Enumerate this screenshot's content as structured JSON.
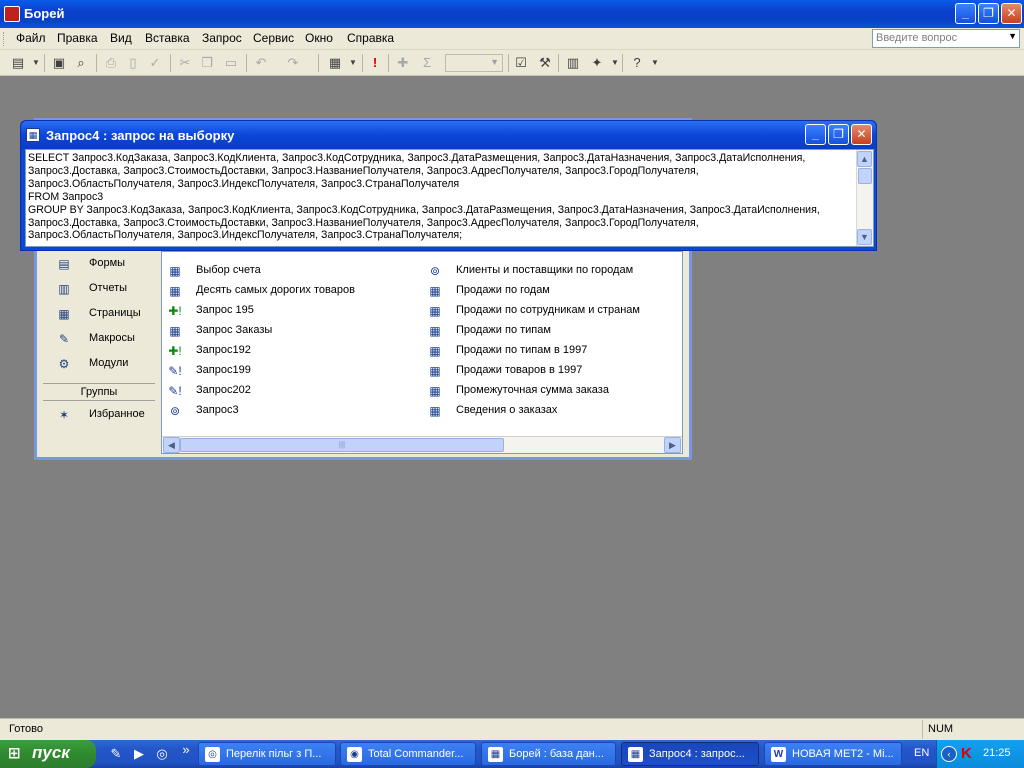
{
  "app": {
    "title": "Борей",
    "window_controls": {
      "minimize": "_",
      "maximize": "❐",
      "close": "✕"
    }
  },
  "menu": {
    "items": [
      "Файл",
      "Правка",
      "Вид",
      "Вставка",
      "Запрос",
      "Сервис",
      "Окно",
      "Справка"
    ],
    "help_placeholder": "Введите вопрос"
  },
  "toolbar": {
    "icons": [
      "view-icon",
      "save-icon",
      "print-preview-icon",
      "print-icon",
      "spell-check-icon",
      "cut-icon",
      "copy-icon",
      "paste-icon",
      "undo-icon",
      "redo-icon",
      "query-type-icon",
      "run-icon",
      "show-table-icon",
      "totals-icon",
      "properties-icon",
      "build-icon",
      "database-window-icon",
      "new-object-icon",
      "help-icon"
    ]
  },
  "query_window": {
    "title": "Запрос4 : запрос на выборку",
    "sql_lines": [
      "SELECT Запрос3.КодЗаказа, Запрос3.КодКлиента, Запрос3.КодСотрудника, Запрос3.ДатаРазмещения, Запрос3.ДатаНазначения, Запрос3.ДатаИсполнения,",
      "Запрос3.Доставка, Запрос3.СтоимостьДоставки, Запрос3.НазваниеПолучателя, Запрос3.АдресПолучателя, Запрос3.ГородПолучателя,",
      "Запрос3.ОбластьПолучателя, Запрос3.ИндексПолучателя, Запрос3.СтранаПолучателя",
      "FROM Запрос3",
      "GROUP BY Запрос3.КодЗаказа, Запрос3.КодКлиента, Запрос3.КодСотрудника, Запрос3.ДатаРазмещения, Запрос3.ДатаНазначения, Запрос3.ДатаИсполнения,",
      "Запрос3.Доставка, Запрос3.СтоимостьДоставки, Запрос3.НазваниеПолучателя, Запрос3.АдресПолучателя, Запрос3.ГородПолучателя,",
      "Запрос3.ОбластьПолучателя, Запрос3.ИндексПолучателя, Запрос3.СтранаПолучателя;"
    ]
  },
  "db_window": {
    "objects": [
      {
        "label": "Формы",
        "icon": "forms-icon",
        "glyph": "▤"
      },
      {
        "label": "Отчеты",
        "icon": "reports-icon",
        "glyph": "▥"
      },
      {
        "label": "Страницы",
        "icon": "pages-icon",
        "glyph": "▦"
      },
      {
        "label": "Макросы",
        "icon": "macros-icon",
        "glyph": "✎"
      },
      {
        "label": "Модули",
        "icon": "modules-icon",
        "glyph": "⚙"
      }
    ],
    "groups_header": "Группы",
    "groups": [
      {
        "label": "Избранное",
        "icon": "favorites-icon",
        "glyph": "✶"
      }
    ],
    "left_column": [
      {
        "label": "Выбор счета",
        "icon": "select-query-icon",
        "glyph": "▦"
      },
      {
        "label": "Десять самых дорогих товаров",
        "icon": "select-query-icon",
        "glyph": "▦"
      },
      {
        "label": "Запрос 195",
        "icon": "append-query-icon",
        "glyph": "✚!"
      },
      {
        "label": "Запрос Заказы",
        "icon": "select-query-icon",
        "glyph": "▦"
      },
      {
        "label": "Запрос192",
        "icon": "append-query-icon",
        "glyph": "✚!"
      },
      {
        "label": "Запрос199",
        "icon": "update-query-icon",
        "glyph": "✎!"
      },
      {
        "label": "Запрос202",
        "icon": "update-query-icon",
        "glyph": "✎!"
      },
      {
        "label": "Запрос3",
        "icon": "union-query-icon",
        "glyph": "⊚"
      }
    ],
    "right_column": [
      {
        "label": "Клиенты и поставщики по городам",
        "icon": "union-query-icon",
        "glyph": "⊚"
      },
      {
        "label": "Продажи по годам",
        "icon": "select-query-icon",
        "glyph": "▦"
      },
      {
        "label": "Продажи по сотрудникам и странам",
        "icon": "select-query-icon",
        "glyph": "▦"
      },
      {
        "label": "Продажи по типам",
        "icon": "select-query-icon",
        "glyph": "▦"
      },
      {
        "label": "Продажи по типам в 1997",
        "icon": "select-query-icon",
        "glyph": "▦"
      },
      {
        "label": "Продажи товаров в 1997",
        "icon": "select-query-icon",
        "glyph": "▦"
      },
      {
        "label": "Промежуточная сумма заказа",
        "icon": "select-query-icon",
        "glyph": "▦"
      },
      {
        "label": "Сведения о заказах",
        "icon": "select-query-icon",
        "glyph": "▦"
      }
    ]
  },
  "status": {
    "text": "Готово",
    "num": "NUM"
  },
  "taskbar": {
    "start_label": "пуск",
    "quick_launch": [
      {
        "icon": "notepad-icon",
        "glyph": "✎"
      },
      {
        "icon": "media-player-icon",
        "glyph": "▶"
      },
      {
        "icon": "opera-icon",
        "glyph": "◎"
      },
      {
        "icon": "more-icon",
        "glyph": "»"
      }
    ],
    "tasks": [
      {
        "label": "Перелік пільг з П...",
        "icon": "opera-icon",
        "glyph": "◎"
      },
      {
        "label": "Total Commander...",
        "icon": "total-commander-icon",
        "glyph": "◉"
      },
      {
        "label": "Борей : база дан...",
        "icon": "access-icon",
        "glyph": "▦"
      },
      {
        "label": "Запрос4 : запрос...",
        "icon": "access-query-icon",
        "glyph": "▦"
      },
      {
        "label": "НОВАЯ МЕТ2 - Mi...",
        "icon": "word-icon",
        "glyph": "W"
      }
    ],
    "lang": "EN",
    "clock": "21:25"
  }
}
